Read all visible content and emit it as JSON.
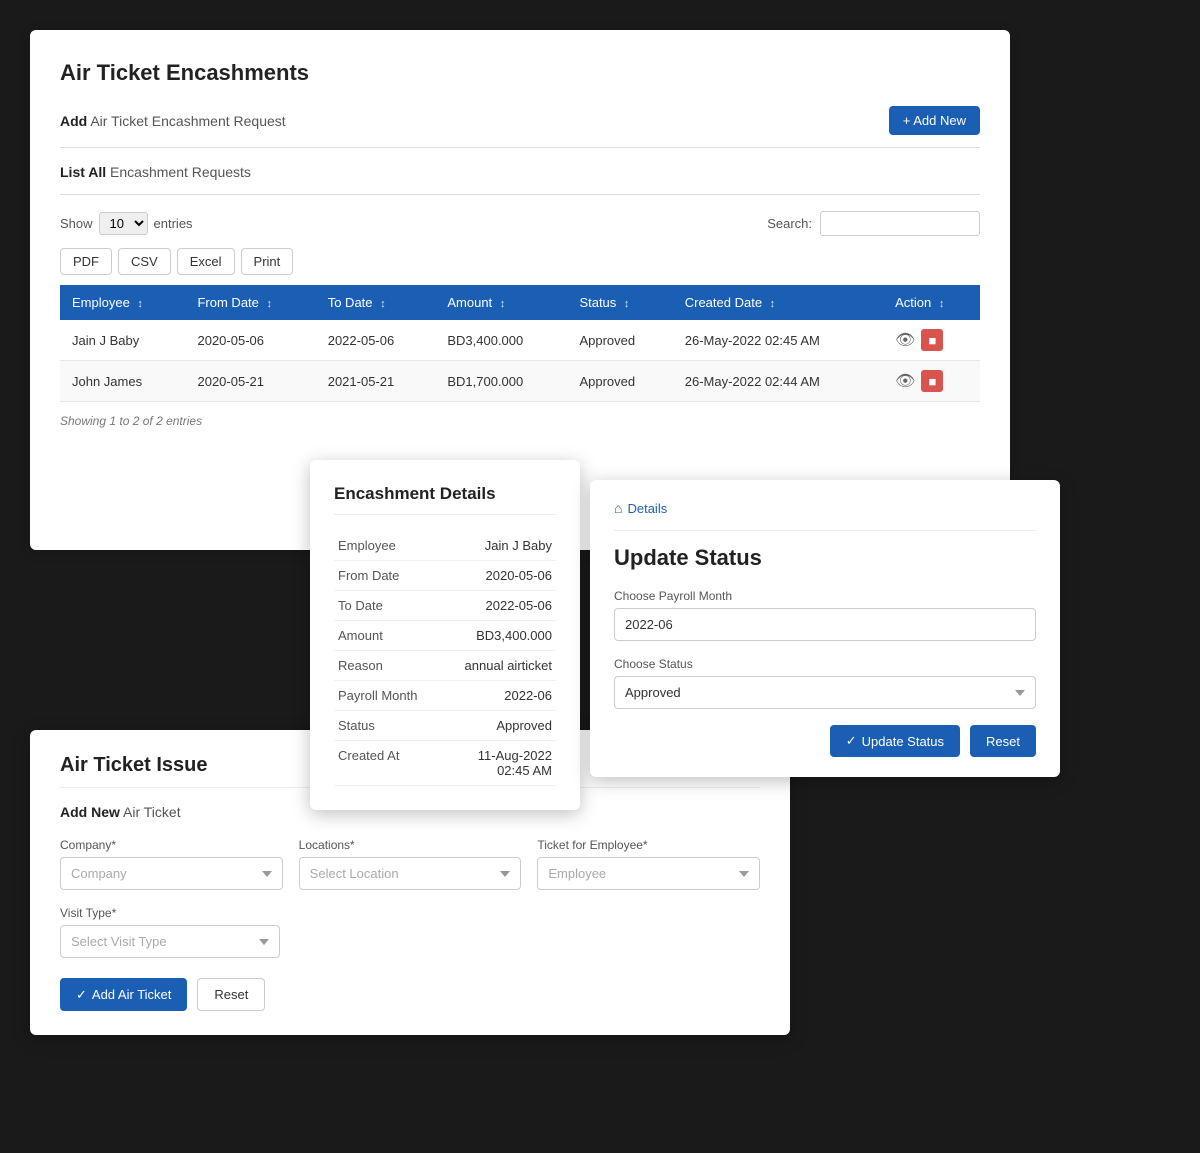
{
  "mainCard": {
    "title": "Air Ticket Encashments",
    "addSection": {
      "label": "Add",
      "description": "Air Ticket Encashment Request",
      "addNewBtn": "+ Add New"
    },
    "listSection": {
      "label": "List All",
      "description": "Encashment Requests"
    },
    "showEntries": {
      "label": "Show",
      "value": "10",
      "suffix": "entries"
    },
    "searchLabel": "Search:",
    "exportBtns": [
      "PDF",
      "CSV",
      "Excel",
      "Print"
    ],
    "tableHeaders": [
      "Employee",
      "From Date",
      "To Date",
      "Amount",
      "Status",
      "Created Date",
      "Action"
    ],
    "tableRows": [
      {
        "employee": "Jain J Baby",
        "fromDate": "2020-05-06",
        "toDate": "2022-05-06",
        "amount": "BD3,400.000",
        "status": "Approved",
        "createdDate": "26-May-2022 02:45 AM"
      },
      {
        "employee": "John James",
        "fromDate": "2020-05-21",
        "toDate": "2021-05-21",
        "amount": "BD1,700.000",
        "status": "Approved",
        "createdDate": "26-May-2022 02:44 AM"
      }
    ],
    "showingText": "Showing 1 to 2 of 2 entries"
  },
  "encashmentDetails": {
    "title": "Encashment Details",
    "fields": [
      {
        "label": "Employee",
        "value": "Jain J Baby"
      },
      {
        "label": "From Date",
        "value": "2020-05-06"
      },
      {
        "label": "To Date",
        "value": "2022-05-06"
      },
      {
        "label": "Amount",
        "value": "BD3,400.000"
      },
      {
        "label": "Reason",
        "value": "annual airticket"
      },
      {
        "label": "Payroll Month",
        "value": "2022-06"
      },
      {
        "label": "Status",
        "value": "Approved"
      },
      {
        "label": "Created At",
        "value": "11-Aug-2022 02:45 AM"
      }
    ]
  },
  "updateStatus": {
    "breadcrumb": "Details",
    "title": "Update Status",
    "payrollMonthLabel": "Choose Payroll Month",
    "payrollMonthValue": "2022-06",
    "chooseStatusLabel": "Choose Status",
    "chooseStatusValue": "Approved",
    "updateBtn": "Update Status",
    "resetBtn": "Reset"
  },
  "airTicketIssue": {
    "title": "Air Ticket Issue",
    "addNewLabel": "Add New",
    "addNewDesc": "Air Ticket",
    "companyLabel": "Company*",
    "companyPlaceholder": "Company",
    "locationsLabel": "Locations*",
    "locationsPlaceholder": "Select Location",
    "ticketForEmployeeLabel": "Ticket for Employee*",
    "ticketForEmployeePlaceholder": "Employee",
    "visitTypeLabel": "Visit Type*",
    "visitTypePlaceholder": "Select Visit Type",
    "addTicketBtn": "Add Air Ticket",
    "resetBtn": "Reset"
  }
}
